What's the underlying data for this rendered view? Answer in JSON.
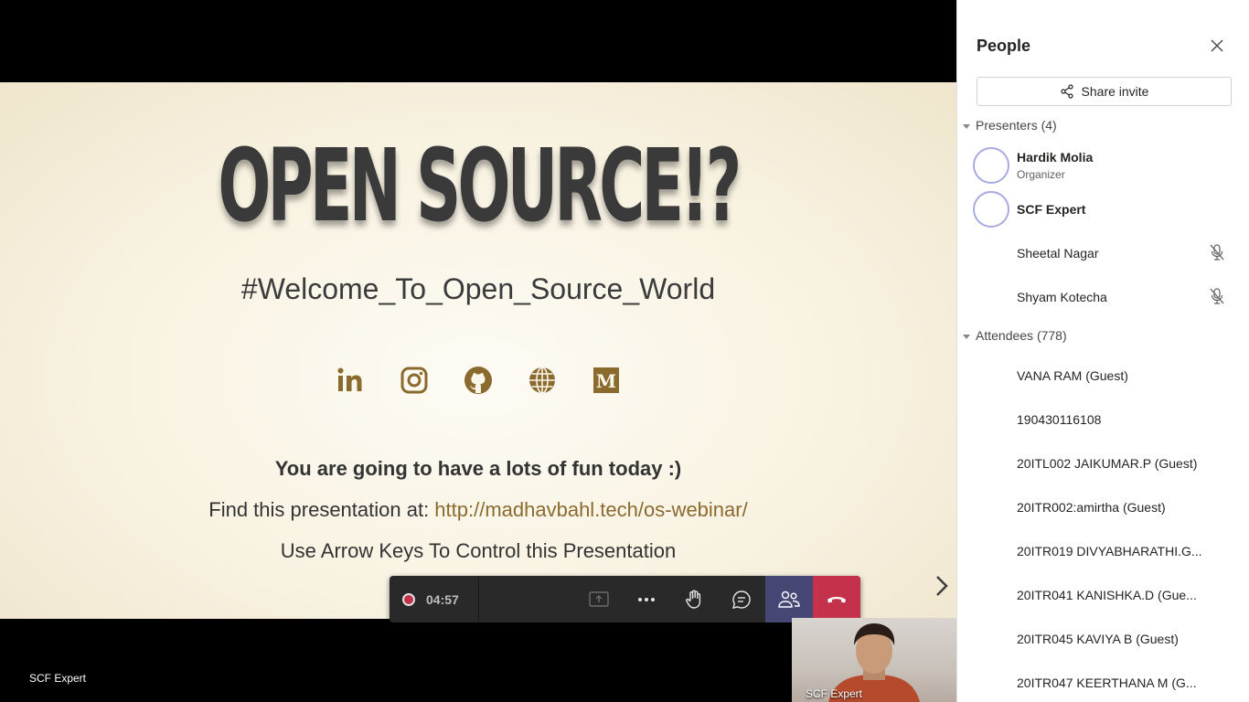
{
  "slide": {
    "title": "OPEN SOURCE!?",
    "hashtag": "#Welcome_To_Open_Source_World",
    "fun_line": "You are going to have a lots of fun today :)",
    "find_prefix": "Find this presentation at: ",
    "find_link": "http://madhavbahl.tech/os-webinar/",
    "keys_line": "Use Arrow Keys To Control this Presentation",
    "social_icons": [
      "linkedin-icon",
      "instagram-icon",
      "github-icon",
      "globe-icon",
      "medium-icon"
    ],
    "accent_color": "#8b6a2e"
  },
  "toolbar": {
    "timer": "04:57",
    "recording_color": "#c4314b",
    "people_active_color": "#464775",
    "hangup_color": "#c4314b"
  },
  "video": {
    "main_label": "SCF Expert",
    "self_label": "SCF Expert"
  },
  "panel": {
    "title": "People",
    "share_invite": "Share invite",
    "presenters_label": "Presenters (4)",
    "presenters": [
      {
        "name": "Hardik Molia",
        "role": "Organizer"
      },
      {
        "name": "SCF Expert",
        "role": ""
      },
      {
        "name": "Sheetal Nagar",
        "role": ""
      },
      {
        "name": "Shyam Kotecha",
        "role": ""
      }
    ],
    "attendees_label": "Attendees (778)",
    "attendees": [
      "VANA RAM (Guest)",
      "190430116108",
      "20ITL002 JAIKUMAR.P (Guest)",
      "20ITR002:amirtha (Guest)",
      "20ITR019 DIVYABHARATHI.G...",
      "20ITR041 KANISHKA.D (Gue...",
      "20ITR045 KAVIYA B (Guest)",
      "20ITR047 KEERTHANA M (G..."
    ]
  }
}
